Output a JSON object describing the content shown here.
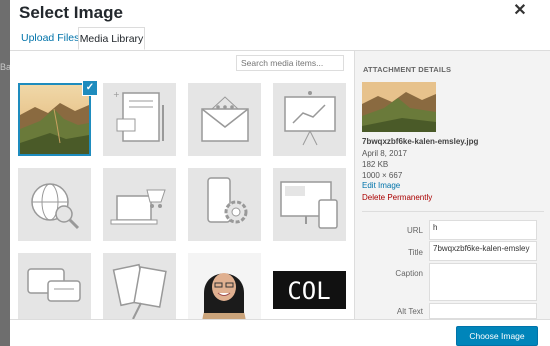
{
  "page": {
    "title": "Select Image",
    "close_icon": "close-icon"
  },
  "tabs": [
    {
      "label": "Upload Files"
    },
    {
      "label": "Media Library"
    }
  ],
  "search": {
    "placeholder": "Search media items..."
  },
  "grid": {
    "items": [
      {
        "kind": "photo",
        "icon": "landscape-photo",
        "selected": true
      },
      {
        "kind": "illustration",
        "icon": "document-icon"
      },
      {
        "kind": "illustration",
        "icon": "mobile-notes-icon"
      },
      {
        "kind": "illustration",
        "icon": "envelope-icon"
      },
      {
        "kind": "illustration",
        "icon": "presentation-chart-icon"
      },
      {
        "kind": "illustration",
        "icon": "globe-search-icon"
      },
      {
        "kind": "illustration",
        "icon": "laptop-cart-icon"
      },
      {
        "kind": "illustration",
        "icon": "mobile-gear-icon"
      },
      {
        "kind": "illustration",
        "icon": "devices-icon"
      },
      {
        "kind": "illustration",
        "icon": "chat-bubbles-icon"
      },
      {
        "kind": "illustration",
        "icon": "art-supplies-icon"
      },
      {
        "kind": "photo",
        "icon": "person-photo"
      },
      {
        "kind": "text",
        "icon": "text-image",
        "text": "COL"
      }
    ],
    "check_icon": "checkmark-icon"
  },
  "details": {
    "heading": "ATTACHMENT DETAILS",
    "filename": "7bwqxzbf6ke-kalen-emsley.jpg",
    "date": "April 8, 2017",
    "size": "182 KB",
    "dimensions": "1000 × 667",
    "edit_label": "Edit Image",
    "delete_label": "Delete Permanently",
    "fields": {
      "url": {
        "label": "URL",
        "value": "h"
      },
      "title": {
        "label": "Title",
        "value": "7bwqxzbf6ke-kalen-emsley"
      },
      "caption": {
        "label": "Caption",
        "value": ""
      },
      "alt": {
        "label": "Alt Text",
        "value": ""
      }
    }
  },
  "footer": {
    "choose_label": "Choose Image"
  },
  "background": {
    "text": "Ba"
  },
  "colors": {
    "accent": "#0085ba",
    "link": "#0073aa",
    "delete": "#aa0000",
    "selected_border": "#1e8cbe"
  }
}
